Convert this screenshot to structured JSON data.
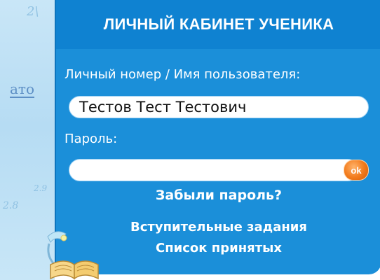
{
  "panel": {
    "title": "ЛИЧНЫЙ КАБИНЕТ УЧЕНИКА"
  },
  "login": {
    "username_label": "Личный номер / Имя пользователя:",
    "username_value": "Тестов Тест Тестович",
    "password_label": "Пароль:",
    "password_value": "",
    "ok_label": "ok"
  },
  "links": {
    "forgot_password": "Забыли пароль?",
    "entrance_tasks": "Вступительные задания",
    "accepted_list": "Список принятых"
  },
  "background": {
    "word_fragment": "ато",
    "scribble_1": "2\\",
    "scribble_2": "2.8",
    "scribble_3": "2.9"
  },
  "colors": {
    "panel_blue": "#1b8fd9",
    "title_blue": "#0f82d1",
    "ok_orange": "#f27a1a",
    "text_white": "#ffffff"
  },
  "icons": {
    "ok": "ok-button-icon",
    "decor": "lamp-and-book-icon"
  }
}
